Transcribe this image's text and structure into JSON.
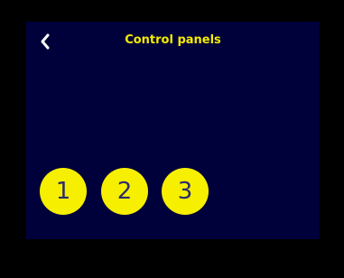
{
  "header": {
    "title": "Control panels",
    "back_icon": "chevron-left-icon"
  },
  "panels": [
    {
      "label": "1"
    },
    {
      "label": "2"
    },
    {
      "label": "3"
    }
  ],
  "colors": {
    "screen_background": "#00003b",
    "accent": "#f5ec00",
    "button_text": "#2b2d6e",
    "bezel": "#000000"
  }
}
